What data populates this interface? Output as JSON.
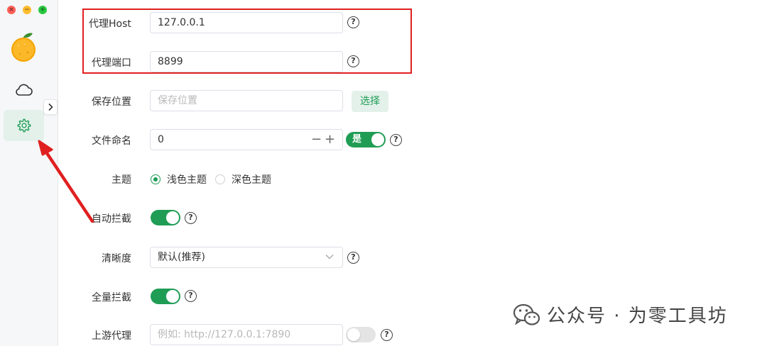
{
  "window": {
    "controls": [
      "×",
      "−",
      "+"
    ]
  },
  "sidebar": {
    "items": [
      {
        "name": "cloud",
        "icon": "cloud-icon"
      },
      {
        "name": "settings",
        "icon": "gear-icon",
        "active": true
      }
    ],
    "collapse_glyph": "›"
  },
  "form": {
    "proxy_host": {
      "label": "代理Host",
      "value": "127.0.0.1"
    },
    "proxy_port": {
      "label": "代理端口",
      "value": "8899"
    },
    "save_location": {
      "label": "保存位置",
      "placeholder": "保存位置",
      "button": "选择"
    },
    "file_naming": {
      "label": "文件命名",
      "value": "0",
      "minus": "−",
      "plus": "+",
      "toggle_label": "是",
      "toggle_on": true
    },
    "theme": {
      "label": "主题",
      "options": [
        "浅色主题",
        "深色主题"
      ],
      "selected": "浅色主题"
    },
    "auto_intercept": {
      "label": "自动拦截",
      "on": true
    },
    "clarity": {
      "label": "清晰度",
      "value": "默认(推荐)"
    },
    "full_intercept": {
      "label": "全量拦截",
      "on": true
    },
    "upstream_proxy": {
      "label": "上游代理",
      "placeholder": "例如: http://127.0.0.1:7890",
      "on": false
    },
    "help_glyph": "?"
  },
  "watermark": {
    "text": "公众号 · 为零工具坊"
  },
  "colors": {
    "accent": "#1f9d55",
    "accent_light": "#e3f1ea",
    "highlight": "#e02020"
  }
}
